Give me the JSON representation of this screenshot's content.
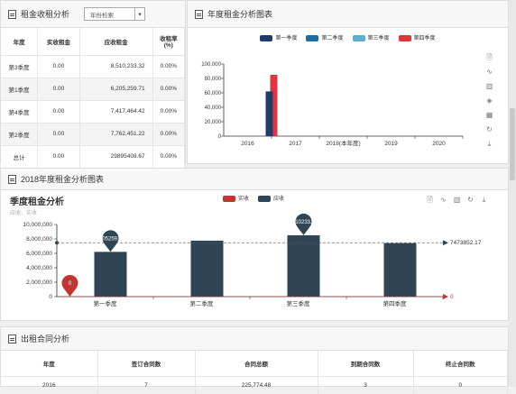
{
  "rent_panel": {
    "title": "租金收租分析",
    "select_value": "年份检索",
    "headers": [
      "年度",
      "实收租金",
      "应收租金",
      "收租率\n(%)"
    ],
    "rows": [
      {
        "period": "第3季度",
        "received": "0.00",
        "receivable": "8,510,233.32",
        "rate": "0.00%"
      },
      {
        "period": "第1季度",
        "received": "0.00",
        "receivable": "6,205,259.71",
        "rate": "0.00%"
      },
      {
        "period": "第4季度",
        "received": "0.00",
        "receivable": "7,417,464.42",
        "rate": "0.00%"
      },
      {
        "period": "第2季度",
        "received": "0.00",
        "receivable": "7,762,451.22",
        "rate": "0.00%"
      },
      {
        "period": "总计",
        "received": "0.00",
        "receivable": "29895408.67",
        "rate": "0.00%"
      }
    ]
  },
  "annual_panel": {
    "title": "年度租金分析图表"
  },
  "quarter_panel": {
    "title": "2018年度租金分析图表",
    "chart_title": "季度租金分析",
    "chart_subtitle": "应收、实收"
  },
  "contract_panel": {
    "title": "出租合同分析",
    "headers": [
      "年度",
      "签订合同数",
      "合同总额",
      "到期合同数",
      "终止合同数"
    ],
    "rows": [
      {
        "year": "2016",
        "signed": "7",
        "total": "225,774.48",
        "expired": "3",
        "terminated": "0"
      }
    ]
  },
  "chart_data": [
    {
      "type": "bar",
      "categories": [
        "2016",
        "2017",
        "2018(本年度)",
        "2019",
        "2020"
      ],
      "series": [
        {
          "name": "第一季度",
          "color": "#1f3c6b",
          "values": [
            0,
            62000,
            0,
            0,
            0
          ]
        },
        {
          "name": "第二季度",
          "color": "#1c6fa6",
          "values": [
            0,
            0,
            0,
            0,
            0
          ]
        },
        {
          "name": "第三季度",
          "color": "#5aaed2",
          "values": [
            0,
            0,
            0,
            0,
            0
          ]
        },
        {
          "name": "第四季度",
          "color": "#e0343f",
          "values": [
            85000,
            0,
            0,
            0,
            0
          ]
        }
      ],
      "ylim": [
        0,
        100000
      ],
      "yticks": [
        "0",
        "20,000",
        "40,000",
        "60,000",
        "80,000",
        "100,000"
      ],
      "legend": "top",
      "grid": false
    },
    {
      "type": "bar",
      "categories": [
        "第一季度",
        "第二季度",
        "第三季度",
        "第四季度"
      ],
      "series": [
        {
          "name": "实收",
          "color": "#c23531",
          "values": [
            0,
            0,
            0,
            0
          ]
        },
        {
          "name": "应收",
          "color": "#2f4554",
          "values": [
            6205259.71,
            7762451.22,
            8510233.32,
            7417464.42
          ]
        }
      ],
      "ylim": [
        0,
        10000000
      ],
      "yticks": [
        "0",
        "2,000,000",
        "4,000,000",
        "6,000,000",
        "8,000,000",
        "10,000,000"
      ],
      "average_line": {
        "value": "7473852.17"
      },
      "received_line_label": "0",
      "max_marker": "8510233.32",
      "min_marker": "6205259.71",
      "received_marker": "0",
      "legend": "top"
    }
  ]
}
